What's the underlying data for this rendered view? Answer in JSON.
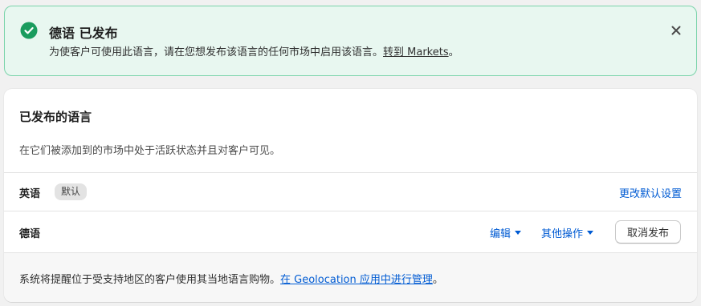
{
  "banner": {
    "icon": "check-circle-icon",
    "title": "德语 已发布",
    "message": "为使客户可使用此语言，请在您想发布该语言的任何市场中启用该语言。",
    "link_text": "转到 Markets",
    "message_end": "。",
    "close_icon": "close-icon",
    "colors": {
      "background": "#e8f7f0",
      "border": "#7ad3aa",
      "icon": "#1a9c5e"
    }
  },
  "card": {
    "title": "已发布的语言",
    "description": "在它们被添加到的市场中处于活跃状态并且对客户可见。",
    "languages": [
      {
        "name": "英语",
        "badge": "默认",
        "action_link": "更改默认设置"
      },
      {
        "name": "德语",
        "edit_label": "编辑",
        "more_label": "其他操作",
        "unpublish_label": "取消发布"
      }
    ],
    "footer": {
      "text": "系统将提醒位于受支持地区的客户使用其当地语言购物。",
      "link_text": "在 Geolocation 应用中进行管理",
      "text_end": "。"
    },
    "colors": {
      "link": "#005bd3"
    }
  }
}
